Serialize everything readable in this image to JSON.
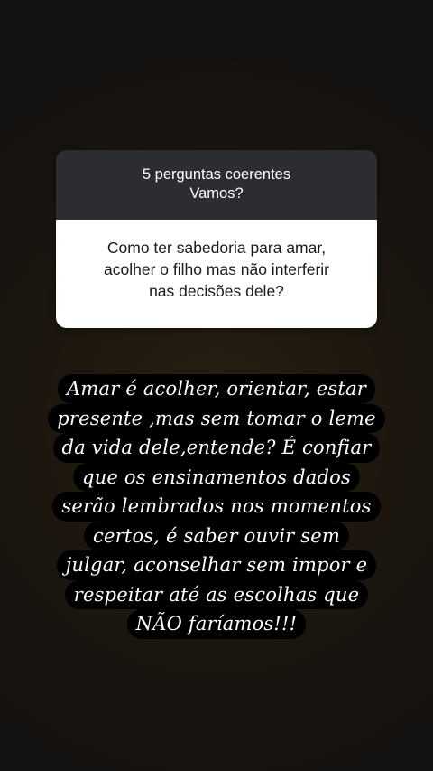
{
  "question_sticker": {
    "header_lines": [
      "5 perguntas coerentes",
      "Vamos?"
    ],
    "question_lines": [
      "Como ter sabedoria para amar,",
      "acolher o filho mas não interferir",
      "nas decisões dele?"
    ]
  },
  "answer": {
    "lines": [
      "Amar é acolher, orientar, estar",
      "presente ,mas sem tomar o leme",
      "da vida dele,entende? É confiar",
      "que os ensinamentos dados",
      "serão lembrados nos momentos",
      "certos, é saber ouvir sem",
      "julgar, aconselhar sem impor e",
      "respeitar até as escolhas que",
      "NÃO  faríamos!!!"
    ]
  },
  "colors": {
    "card_header": "#2b2d31",
    "card_body": "#ffffff",
    "text_highlight": "#000000",
    "background": "#1c160e"
  }
}
